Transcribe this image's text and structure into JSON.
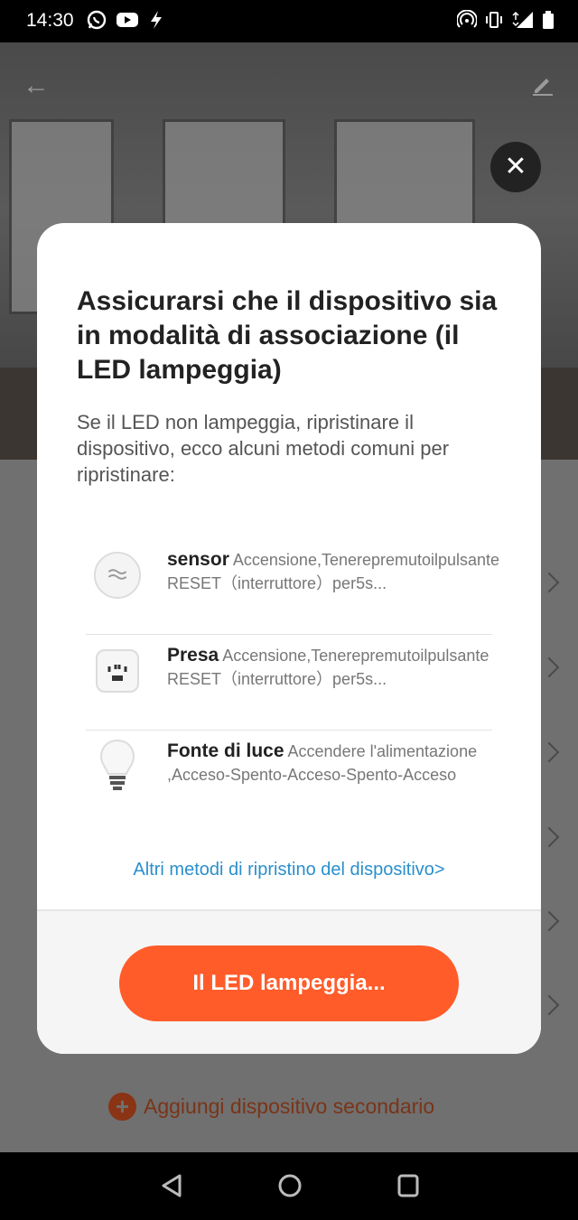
{
  "status_bar": {
    "time": "14:30"
  },
  "dialog": {
    "title": "Assicurarsi che il dispositivo sia in modalità di associazione (il LED lampeggia)",
    "description": "Se il LED non lampeggia, ripristinare il dispositivo, ecco alcuni metodi comuni per ripristinare:",
    "methods": [
      {
        "name": "sensor",
        "text": "Accensione,Tenerepremutoilpulsante RESET（interruttore）per5s...",
        "icon": "sensor-icon"
      },
      {
        "name": "Presa",
        "text": "Accensione,Tenerepremutoilpulsante RESET（interruttore）per5s...",
        "icon": "plug-icon"
      },
      {
        "name": "Fonte di luce",
        "text": "Accendere l'alimentazione ,Acceso-Spento-Acceso-Spento-Acceso",
        "icon": "light-bulb-icon"
      }
    ],
    "more_link": "Altri metodi di ripristino del dispositivo>",
    "confirm_button": "Il LED lampeggia..."
  },
  "background": {
    "add_secondary": "Aggiungi dispositivo secondario"
  },
  "colors": {
    "accent": "#ff5c2a",
    "link": "#2a8fcc"
  }
}
